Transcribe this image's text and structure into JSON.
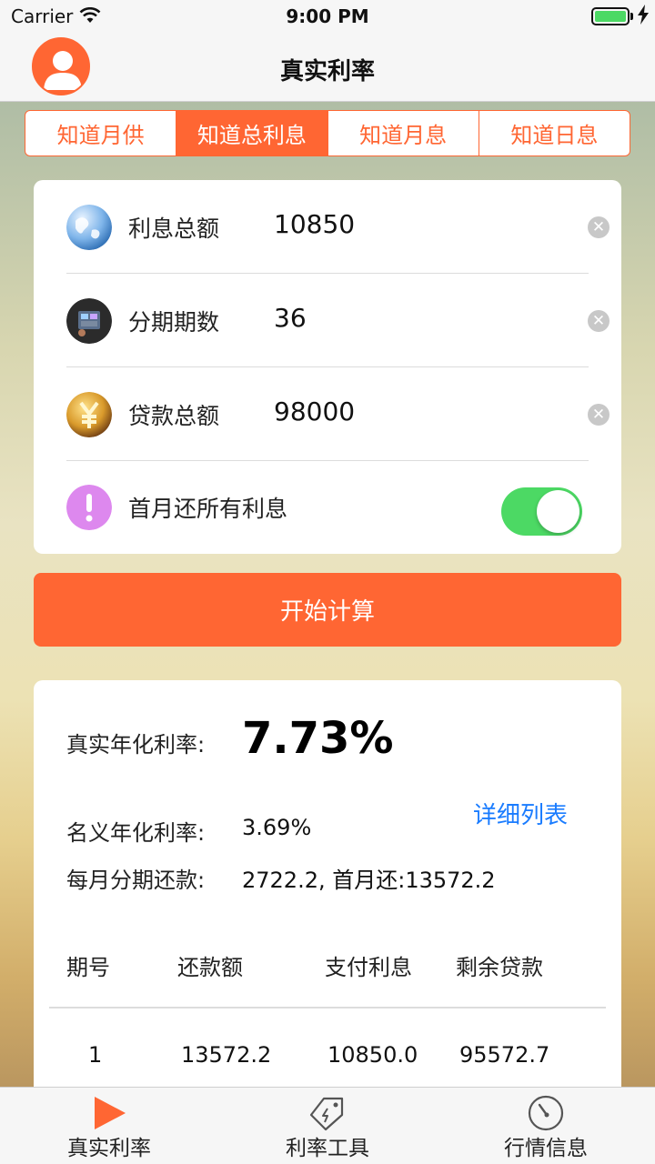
{
  "status_bar": {
    "carrier": "Carrier",
    "time": "9:00 PM"
  },
  "nav": {
    "title": "真实利率",
    "avatar_icon": "user-avatar-icon"
  },
  "segments": [
    {
      "label": "知道月供",
      "active": false
    },
    {
      "label": "知道总利息",
      "active": true
    },
    {
      "label": "知道月息",
      "active": false
    },
    {
      "label": "知道日息",
      "active": false
    }
  ],
  "form": {
    "rows": [
      {
        "label": "利息总额",
        "value": "10850",
        "icon": "globe-icon"
      },
      {
        "label": "分期期数",
        "value": "36",
        "icon": "phone-photo-icon"
      },
      {
        "label": "贷款总额",
        "value": "98000",
        "icon": "yuan-coin-icon"
      }
    ],
    "first_month_label": "首月还所有利息",
    "first_month_on": true,
    "toggle_color": "#4cd964"
  },
  "calc_button": "开始计算",
  "result": {
    "real_rate_label": "真实年化利率:",
    "real_rate_value": "7.73%",
    "detail_link": "详细列表",
    "nominal_label": "名义年化利率:",
    "nominal_value": "3.69%",
    "monthly_label": "每月分期还款:",
    "monthly_value": "2722.2, 首月还:13572.2",
    "table": {
      "headers": [
        "期号",
        "还款额",
        "支付利息",
        "剩余贷款"
      ],
      "rows": [
        [
          "1",
          "13572.2",
          "10850.0",
          "95572.7"
        ]
      ]
    }
  },
  "tabs": [
    {
      "label": "真实利率",
      "icon": "play-icon",
      "active": true
    },
    {
      "label": "利率工具",
      "icon": "tag-tool-icon",
      "active": false
    },
    {
      "label": "行情信息",
      "icon": "gauge-icon",
      "active": false
    }
  ],
  "accent_color": "#ff6633",
  "link_color": "#1a7cff"
}
